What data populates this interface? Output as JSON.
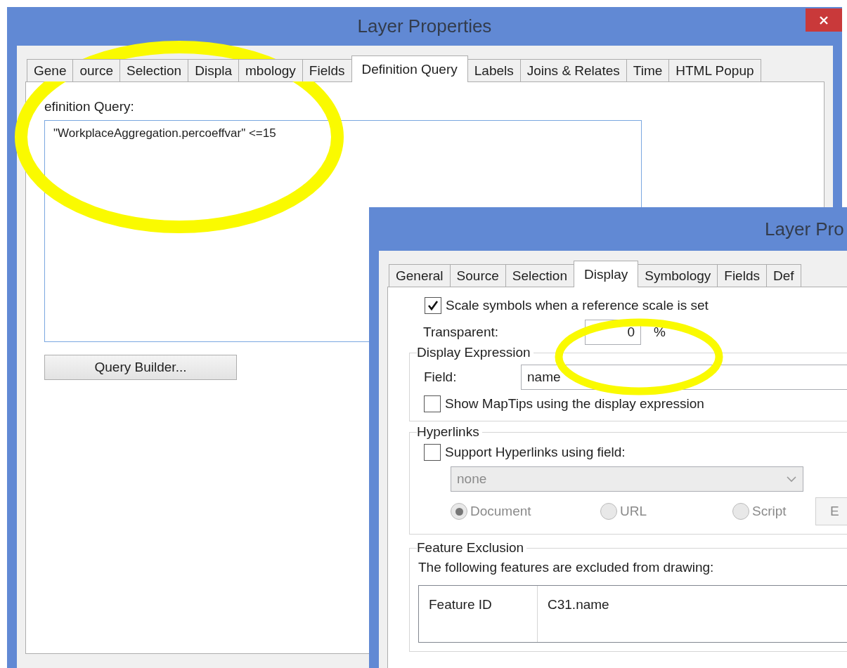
{
  "back_window": {
    "title": "Layer Properties",
    "tabs": [
      {
        "label": "Gene",
        "selected": false
      },
      {
        "label": "ource",
        "selected": false
      },
      {
        "label": "Selection",
        "selected": false
      },
      {
        "label": "Displa",
        "selected": false
      },
      {
        "label": "mbology",
        "selected": false
      },
      {
        "label": "Fields",
        "selected": false
      },
      {
        "label": "Definition Query",
        "selected": true
      },
      {
        "label": "Labels",
        "selected": false
      },
      {
        "label": "Joins & Relates",
        "selected": false
      },
      {
        "label": "Time",
        "selected": false
      },
      {
        "label": "HTML Popup",
        "selected": false
      }
    ],
    "query_label": "efinition Query:",
    "query": "\"WorkplaceAggregation.percoeffvar\" <=15",
    "query_builder_button": "Query Builder..."
  },
  "front_window": {
    "title": "Layer Pro",
    "tabs": [
      {
        "label": "General",
        "selected": false
      },
      {
        "label": "Source",
        "selected": false
      },
      {
        "label": "Selection",
        "selected": false
      },
      {
        "label": "Display",
        "selected": true
      },
      {
        "label": "Symbology",
        "selected": false
      },
      {
        "label": "Fields",
        "selected": false
      },
      {
        "label": "Def",
        "selected": false
      }
    ],
    "scale_symbols": {
      "label": "Scale symbols when a reference scale is set",
      "checked": true
    },
    "transparent": {
      "label": "Transparent:",
      "value": "0",
      "unit": "%"
    },
    "display_expression": {
      "title": "Display Expression",
      "field_label": "Field:",
      "field_value": "name",
      "maptips": {
        "label": "Show MapTips using the display expression",
        "checked": false
      }
    },
    "hyperlinks": {
      "title": "Hyperlinks",
      "support": {
        "label": "Support Hyperlinks using field:",
        "checked": false
      },
      "field_select": {
        "value": "none",
        "disabled": true
      },
      "options": [
        {
          "label": "Document",
          "selected": true,
          "disabled": true
        },
        {
          "label": "URL",
          "selected": false,
          "disabled": true
        },
        {
          "label": "Script",
          "selected": false,
          "disabled": true
        }
      ],
      "button": {
        "label": "E",
        "disabled": true
      }
    },
    "feature_exclusion": {
      "title": "Feature Exclusion",
      "description": "The following features are excluded from drawing:",
      "table": {
        "columns": [
          "Feature ID",
          "C31.name"
        ]
      }
    }
  }
}
